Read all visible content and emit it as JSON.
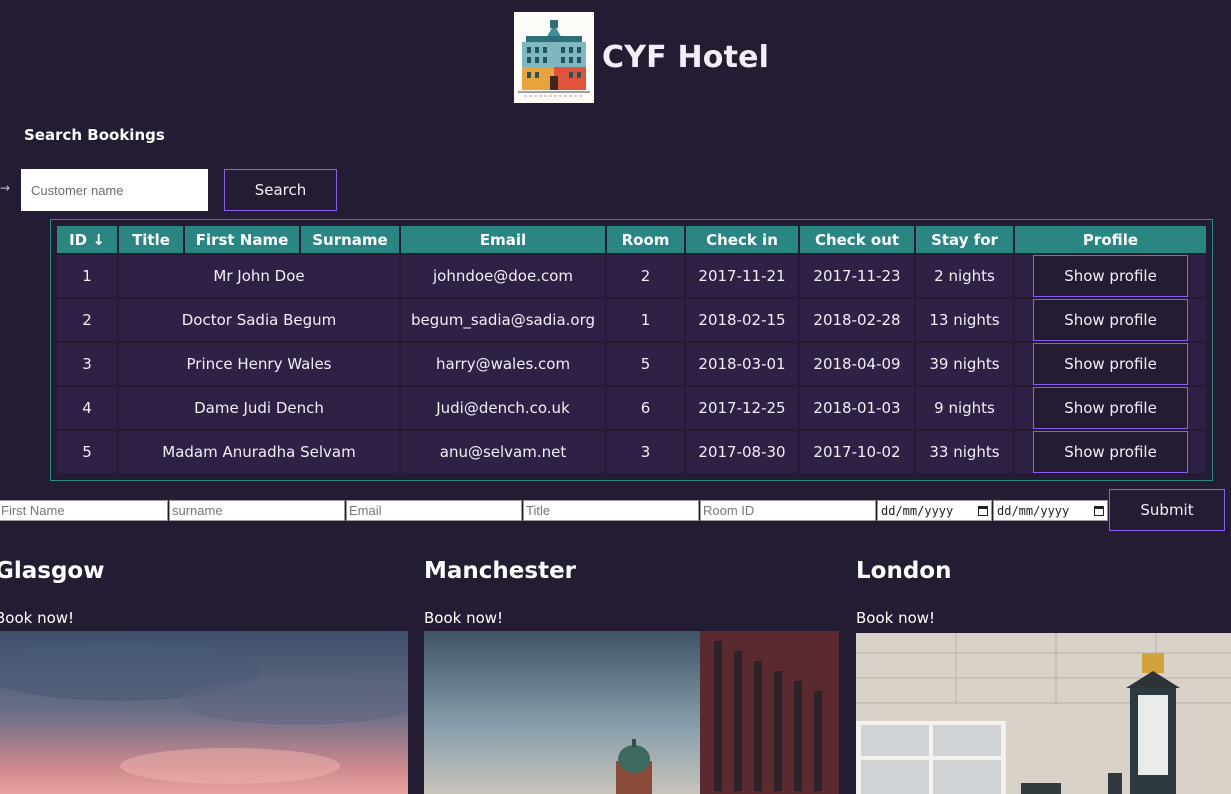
{
  "header": {
    "title": "CYF Hotel",
    "logo_icon": "hotel-building-icon"
  },
  "search": {
    "heading": "Search Bookings",
    "arrow": "→",
    "placeholder": "Customer name",
    "button_label": "Search"
  },
  "table": {
    "headers": [
      "ID ↓",
      "Title",
      "First Name",
      "Surname",
      "Email",
      "Room",
      "Check in",
      "Check out",
      "Stay for",
      "Profile"
    ],
    "rows": [
      {
        "id": "1",
        "name": "Mr John Doe",
        "email": "johndoe@doe.com",
        "room": "2",
        "check_in": "2017-11-21",
        "check_out": "2017-11-23",
        "stay": "2 nights",
        "profile": "Show profile"
      },
      {
        "id": "2",
        "name": "Doctor Sadia Begum",
        "email": "begum_sadia@sadia.org",
        "room": "1",
        "check_in": "2018-02-15",
        "check_out": "2018-02-28",
        "stay": "13 nights",
        "profile": "Show profile"
      },
      {
        "id": "3",
        "name": "Prince Henry Wales",
        "email": "harry@wales.com",
        "room": "5",
        "check_in": "2018-03-01",
        "check_out": "2018-04-09",
        "stay": "39 nights",
        "profile": "Show profile"
      },
      {
        "id": "4",
        "name": "Dame Judi Dench",
        "email": "Judi@dench.co.uk",
        "room": "6",
        "check_in": "2017-12-25",
        "check_out": "2018-01-03",
        "stay": "9 nights",
        "profile": "Show profile"
      },
      {
        "id": "5",
        "name": "Madam Anuradha Selvam",
        "email": "anu@selvam.net",
        "room": "3",
        "check_in": "2017-08-30",
        "check_out": "2017-10-02",
        "stay": "33 nights",
        "profile": "Show profile"
      }
    ]
  },
  "booking_form": {
    "first_name_placeholder": "First Name",
    "surname_placeholder": "surname",
    "email_placeholder": "Email",
    "title_placeholder": "Title",
    "room_placeholder": "Room ID",
    "date_placeholder": "dd/mm/yyyy",
    "submit_label": "Submit"
  },
  "cities": [
    {
      "name": "Glasgow",
      "link": "Book now!"
    },
    {
      "name": "Manchester",
      "link": "Book now!"
    },
    {
      "name": "London",
      "link": "Book now!"
    }
  ],
  "colors": {
    "background": "#241c33",
    "table_header": "#2a8683",
    "table_cell": "#2f2145",
    "button_border": "#8a5cf0"
  }
}
